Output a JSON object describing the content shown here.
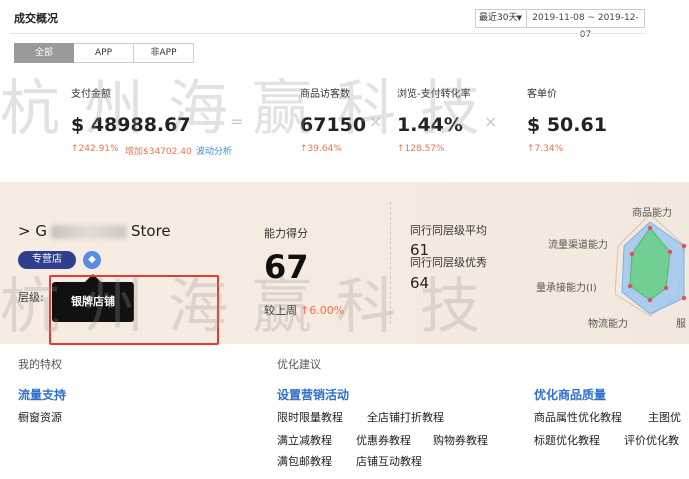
{
  "overview": {
    "title": "成交概况",
    "range_label": "最近30天",
    "date_range": "2019-11-08 ~ 2019-12-07",
    "tabs": [
      "全部",
      "APP",
      "非APP"
    ],
    "metrics": [
      {
        "label": "支付金额",
        "value": "$ 48988.67"
      },
      {
        "label": "商品访客数",
        "value": "67150"
      },
      {
        "label": "浏览-支付转化率",
        "value": "1.44%"
      },
      {
        "label": "客单价",
        "value": "$ 50.61"
      }
    ],
    "operators": [
      "=",
      "×",
      "×"
    ],
    "changes": {
      "pay": "↑242.91%",
      "pay_increase": "增加$34702.40",
      "analysis_link": "波动分析",
      "visitors": "↑39.64%",
      "conversion": "↑128.57%",
      "avg_price": "↑7.34%"
    }
  },
  "store": {
    "arrow": ">",
    "name_prefix": "G",
    "name_suffix": "Store",
    "badge": "专营店",
    "level_label": "层级:",
    "tooltip": "银牌店铺",
    "score_label": "能力得分",
    "score": "67",
    "week_label": "较上周",
    "week_change": "↑6.00%",
    "peer_avg_label": "同行同层级平均",
    "peer_avg": "61",
    "peer_excellent_label": "同行同层级优秀",
    "peer_excellent": "64",
    "radar_labels": [
      "商品能力",
      "流量渠道能力",
      "量承接能力(I)",
      "物流能力",
      "服"
    ],
    "radar_colors": {
      "outer": "#9ec7ef",
      "inner": "#6ccf8a",
      "point": "#e0505c"
    }
  },
  "privileges": {
    "heading": "我的特权",
    "category": "流量支持",
    "items": [
      "橱窗资源"
    ]
  },
  "suggestions": {
    "heading": "优化建议",
    "marketing": {
      "title": "设置营销活动",
      "rows": [
        [
          "限时限量教程",
          "全店铺打折教程"
        ],
        [
          "满立减教程",
          "优惠券教程",
          "购物券教程"
        ],
        [
          "满包邮教程",
          "店铺互动教程"
        ]
      ]
    },
    "quality": {
      "title": "优化商品质量",
      "rows": [
        [
          "商品属性优化教程",
          "主图优"
        ],
        [
          "标题优化教程",
          "评价优化教"
        ]
      ]
    }
  },
  "watermark": "杭州海赢科技"
}
